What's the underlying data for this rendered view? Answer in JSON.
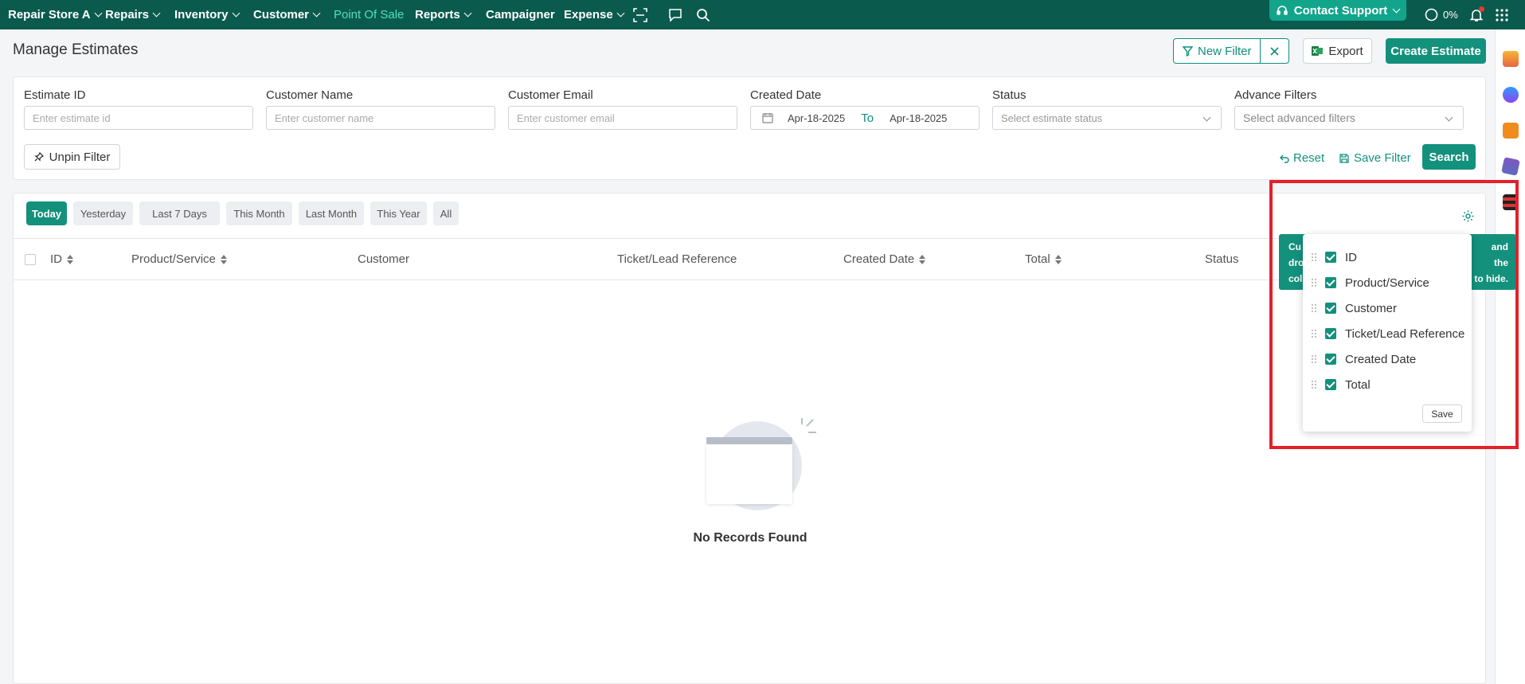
{
  "nav": {
    "store": "Repair Store A",
    "items": [
      "Repairs",
      "Inventory",
      "Customer",
      "Point Of Sale",
      "Reports",
      "Campaigner",
      "Expense"
    ],
    "contact_support": "Contact Support",
    "progress": "0%"
  },
  "page": {
    "title": "Manage Estimates",
    "new_filter": "New Filter",
    "export": "Export",
    "create_estimate": "Create Estimate"
  },
  "filters": {
    "estimate_id_label": "Estimate ID",
    "estimate_id_placeholder": "Enter estimate id",
    "customer_name_label": "Customer Name",
    "customer_name_placeholder": "Enter customer name",
    "customer_email_label": "Customer Email",
    "customer_email_placeholder": "Enter customer email",
    "created_date_label": "Created Date",
    "date_from": "Apr-18-2025",
    "date_to_label": "To",
    "date_to": "Apr-18-2025",
    "status_label": "Status",
    "status_placeholder": "Select estimate status",
    "advance_label": "Advance Filters",
    "advance_placeholder": "Select advanced filters",
    "unpin": "Unpin Filter",
    "reset": "Reset",
    "save_filter": "Save Filter",
    "search": "Search"
  },
  "date_tabs": [
    "Today",
    "Yesterday",
    "Last 7 Days",
    "This Month",
    "Last Month",
    "This Year",
    "All"
  ],
  "table": {
    "headers": [
      "ID",
      "Product/Service",
      "Customer",
      "Ticket/Lead Reference",
      "Created Date",
      "Total",
      "Status"
    ],
    "empty_text": "No Records Found"
  },
  "tooltip": {
    "line1_start": "Cu",
    "line1_end": "and",
    "line2_start": "dro",
    "line2_end": "the",
    "line3_start": "col",
    "line3_end": "to hide."
  },
  "column_popup": {
    "columns": [
      "ID",
      "Product/Service",
      "Customer",
      "Ticket/Lead Reference",
      "Created Date",
      "Total"
    ],
    "save": "Save"
  },
  "colors": {
    "nav_bg": "#0b5a4e",
    "accent": "#13917d",
    "highlight": "#e5202a"
  }
}
